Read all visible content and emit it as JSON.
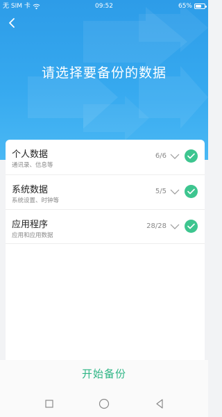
{
  "status_bar": {
    "carrier": "无 SIM 卡",
    "time": "09:52",
    "battery_percent": "65%",
    "battery_level": 0.65,
    "icons": [
      "wifi-icon",
      "battery-icon"
    ]
  },
  "header": {
    "title": "请选择要备份的数据",
    "back_icon": "back-arrow-icon"
  },
  "items": [
    {
      "title": "个人数据",
      "subtitle": "通讯录、信息等",
      "count": "6/6",
      "checked": true
    },
    {
      "title": "系统数据",
      "subtitle": "系统设置、时钟等",
      "count": "5/5",
      "checked": true
    },
    {
      "title": "应用程序",
      "subtitle": "应用和应用数据",
      "count": "28/28",
      "checked": true
    }
  ],
  "actions": {
    "start_label": "开始备份"
  },
  "navbar": {
    "icons": [
      "recent-apps-icon",
      "home-icon",
      "back-icon"
    ]
  },
  "colors": {
    "header_blue": "#36a9ef",
    "check_green": "#3dc58f",
    "action_green": "#2eb585"
  }
}
